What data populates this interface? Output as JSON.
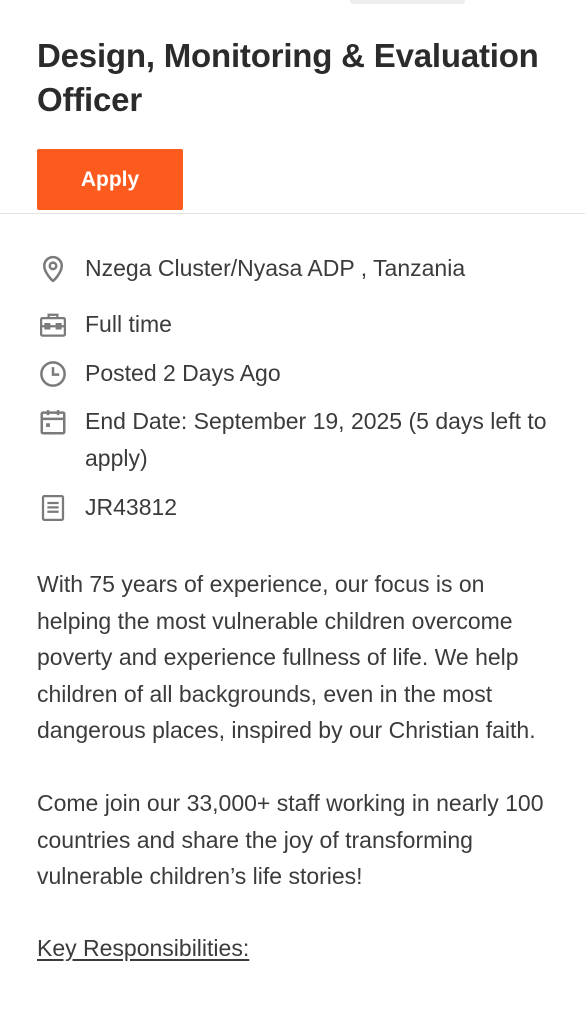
{
  "job": {
    "title": "Design, Monitoring & Evaluation Officer",
    "apply_label": "Apply"
  },
  "details": {
    "location": "Nzega Cluster/Nyasa ADP , Tanzania",
    "time_type": "Full time",
    "posted": "Posted 2 Days Ago",
    "end_date": "End Date: September 19, 2025 (5 days left to apply)",
    "requisition_id": "JR43812"
  },
  "icons": {
    "location": "location-pin-icon",
    "time_type": "briefcase-icon",
    "posted": "clock-icon",
    "end_date": "calendar-icon",
    "requisition_id": "document-icon"
  },
  "description": {
    "paragraph_1": "With 75 years of experience, our focus is on helping the most vulnerable children overcome poverty and experience fullness of life. We help children of all backgrounds, even in the most dangerous places, inspired by our Christian faith.",
    "paragraph_2": "Come join our 33,000+ staff working in nearly 100 countries and share the joy of transforming vulnerable children’s life stories!",
    "section_heading": "Key Responsibilities:"
  },
  "colors": {
    "accent": "#fd5a1e",
    "icon": "#7a7a7a",
    "text": "#3b3b3b",
    "title": "#2b2b2b"
  }
}
